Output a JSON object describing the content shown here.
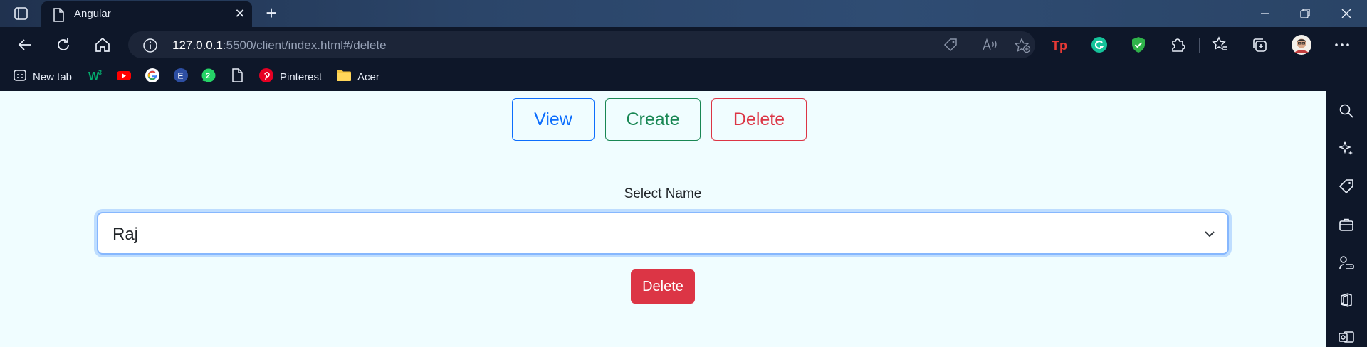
{
  "browser": {
    "tab_title": "Angular",
    "url_host": "127.0.0.1",
    "url_rest": ":5500/client/index.html#/delete",
    "bookmarks": [
      {
        "label": "New tab",
        "icon": "new-tab-icon"
      },
      {
        "label": "",
        "icon": "w3schools-icon"
      },
      {
        "label": "",
        "icon": "youtube-icon"
      },
      {
        "label": "",
        "icon": "google-icon"
      },
      {
        "label": "",
        "icon": "e-icon"
      },
      {
        "label": "",
        "icon": "whatsapp-icon"
      },
      {
        "label": "",
        "icon": "page-icon"
      },
      {
        "label": "Pinterest",
        "icon": "pinterest-icon"
      },
      {
        "label": "Acer",
        "icon": "folder-icon"
      }
    ]
  },
  "page": {
    "nav": {
      "view_label": "View",
      "create_label": "Create",
      "delete_label": "Delete"
    },
    "form": {
      "select_label": "Select Name",
      "selected_value": "Raj",
      "submit_label": "Delete"
    }
  },
  "colors": {
    "primary": "#0d6efd",
    "success": "#198754",
    "danger": "#dc3545",
    "page_bg": "#f0fdff"
  }
}
